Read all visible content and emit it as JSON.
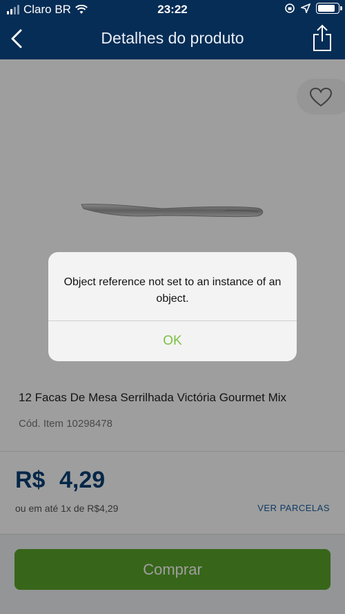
{
  "status_bar": {
    "carrier": "Claro BR",
    "time": "23:22",
    "battery_level": 0.85
  },
  "nav": {
    "title": "Detalhes do produto",
    "back_icon": "chevron-left-icon",
    "share_icon": "share-icon"
  },
  "product": {
    "name": "12 Facas De Mesa Serrilhada Victória Gourmet Mix",
    "code": "Cód. Item 10298478",
    "favorite_icon": "heart-icon"
  },
  "price": {
    "currency": "R$",
    "value": "4,29",
    "installments": "ou em até 1x de R$4,29",
    "installments_link": "VER PARCELAS"
  },
  "buy_button": {
    "label": "Comprar"
  },
  "alert": {
    "message": "Object reference not set to an instance of an object.",
    "ok_label": "OK"
  },
  "colors": {
    "header": "#062d56",
    "price": "#0b3f74",
    "buy": "#5aa52a",
    "ok": "#7bc143"
  }
}
